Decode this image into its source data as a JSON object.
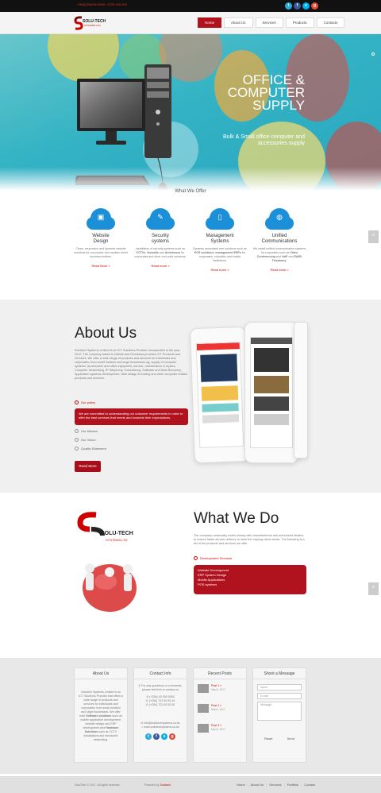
{
  "topbar": {
    "phone": "+254(020)000 0000 / 0720 000 000",
    "socials": [
      {
        "icon": "twitter-icon",
        "glyph": "t",
        "color": "#2aa9e0"
      },
      {
        "icon": "facebook-icon",
        "glyph": "f",
        "color": "#3b5998"
      },
      {
        "icon": "skype-icon",
        "glyph": "s",
        "color": "#00aff0"
      },
      {
        "icon": "google-plus-icon",
        "glyph": "g",
        "color": "#dd4b39"
      }
    ]
  },
  "header": {
    "logo_text": "SOLU-TECH",
    "logo_sub": "SYSTEMS LTD",
    "nav": [
      "Home",
      "About Us",
      "Services",
      "Products",
      "Contacts"
    ]
  },
  "hero": {
    "title_line1": "OFFICE &",
    "title_line2": "COMPUTER",
    "title_line3": "SUPPLY",
    "subtitle": "Bulk & Small office computer and accessories supply"
  },
  "offer": {
    "title": "What We Offer",
    "items": [
      {
        "title_line1": "Website",
        "title_line2": "Design",
        "text": "Clean, responsive and dynamic website solutions for corporates and medium sized business entities.",
        "link": "Read More »",
        "glyph": "▣"
      },
      {
        "title_line1": "Security",
        "title_line2": "systems",
        "text": "Installation of security systems such as CCTVs, firewalls and Antiviruses for corporates and other end point solutions.",
        "link": "Read more »",
        "glyph": "✎"
      },
      {
        "title_line1": "Management",
        "title_line2": "Systems",
        "text": "Dynamic automated erm solutions such as POS solutions, management ERPs for corporates, education and health institutions.",
        "link": "Read more »",
        "glyph": "▯"
      },
      {
        "title_line1": "Unified",
        "title_line2": "Communications",
        "text": "We install unified communication systems for corporates such as Video Conferencing and VoIP and PABX Telephony.",
        "link": "Read more »",
        "glyph": "◍"
      }
    ]
  },
  "about": {
    "title": "About Us",
    "text": "Solutech Systems Limited is an ICT Solutions Provider incorporated in the year 2012. The company based in Nairobi and Mombasa provides ICT Products and Services. We offer a wide range of products and services for individuals and corporates; from small medium and large businesses eg, supply of computer systems, accessories and office equipment, service, maintenance & repairs, Computer Networking, IP Telephony, Consultancy, Software and Data Recovery, Application systems development, Web design & hosting and other computer related products and services.",
    "accordion": [
      "Our policy",
      "Our Mission",
      "Our Vision",
      "Quality Statement"
    ],
    "policy_text": "We are committed to understanding our customer requirements in order to offer the best services that meets and exceeds their expectations.",
    "button": "Read More"
  },
  "wwd": {
    "title": "What We Do",
    "text": "The company continually works closely with manufacturers and authorized dealers to ensure faster service delivery to meet the varying client needs. The following is a list of the products and services we offer",
    "accordion_label": "Development Services",
    "items": [
      "Website Development",
      "ERP System Design",
      "Mobile Applications",
      "POS systems"
    ],
    "logo_text": "SOLU-TECH",
    "logo_sub": "SYSTEMS LTD"
  },
  "footer": {
    "about": {
      "title": "About Us",
      "text_start": "Solutech Systems Limited is an ICT Solutions Provider that offers a wide range of products and services for individuals and corporates; from small medium and large businesses. We offer both ",
      "bold1": "Software solutions",
      "text_mid": " such as mobile application development, website design and ERP development and ",
      "bold2": "Hardware Solutions",
      "text_end": " such as CCTV installations and structured networking."
    },
    "contact": {
      "title": "Contact Info",
      "lines": [
        "For any questions or comments, please feel free to contact us",
        "(+254) 20 000 0000",
        "(+254) 722 00 00 44",
        "(+254) 722 00 00 00",
        "info@solutechsystems.co.ke",
        "www.solutechsystems.co.ke"
      ]
    },
    "posts": {
      "title": "Recent Posts",
      "items": [
        {
          "title": "Post 1 »",
          "date": "March, 2017"
        },
        {
          "title": "Post 2 »",
          "date": "March, 2017"
        },
        {
          "title": "Post 3 »",
          "date": "March, 2017"
        }
      ]
    },
    "message": {
      "title": "Shoot a Message",
      "name": "Name",
      "email": "E-mail",
      "message": "Message",
      "reset": "Reset",
      "send": "Send"
    }
  },
  "bottom": {
    "copyright": "SoluTech © 2017. All rights reserved.",
    "powered": "Powered by",
    "powered_by": "Solutech",
    "nav": [
      "Home",
      "About Us",
      "Services",
      "Portfolio",
      "Contact"
    ]
  },
  "colors": {
    "brand_red": "#b0121e",
    "accent_blue": "#1b8fd8"
  }
}
